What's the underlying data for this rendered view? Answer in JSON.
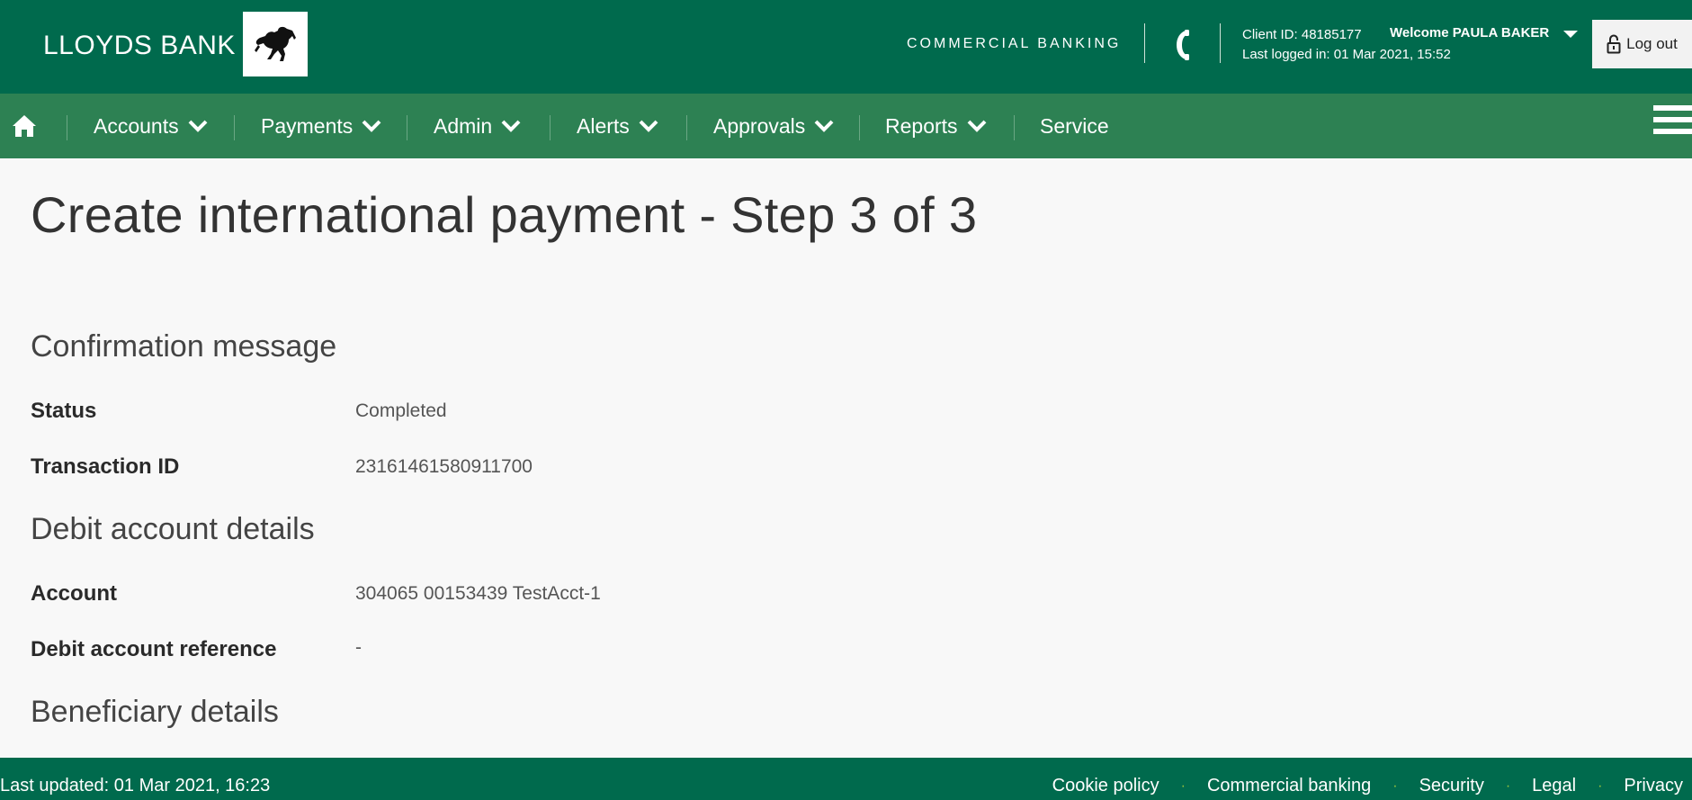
{
  "header": {
    "brand": "LLOYDS BANK",
    "section": "COMMERCIAL BANKING",
    "client_id": "Client ID: 48185177",
    "last_logged_in": "Last logged in: 01 Mar 2021, 15:52",
    "welcome": "Welcome PAULA BAKER",
    "logout": "Log out"
  },
  "nav": {
    "items": [
      {
        "label": "Accounts"
      },
      {
        "label": "Payments"
      },
      {
        "label": "Admin"
      },
      {
        "label": "Alerts"
      },
      {
        "label": "Approvals"
      },
      {
        "label": "Reports"
      },
      {
        "label": "Service"
      }
    ]
  },
  "main": {
    "title": "Create international payment - Step 3 of 3",
    "confirmation": {
      "heading": "Confirmation message",
      "status_label": "Status",
      "status_value": "Completed",
      "txn_label": "Transaction ID",
      "txn_value": "23161461580911700"
    },
    "debit": {
      "heading": "Debit account details",
      "account_label": "Account",
      "account_value": "304065 00153439 TestAcct-1",
      "ref_label": "Debit account reference",
      "ref_value": "-"
    },
    "beneficiary": {
      "heading": "Beneficiary details"
    }
  },
  "footer": {
    "last_updated": "Last updated: 01 Mar 2021, 16:23",
    "links": [
      "Cookie policy",
      "Commercial banking",
      "Security",
      "Legal",
      "Privacy"
    ]
  },
  "colors": {
    "header_green": "#006a4d",
    "nav_green": "#2d8153",
    "footer_dot": "#9ac43c"
  }
}
